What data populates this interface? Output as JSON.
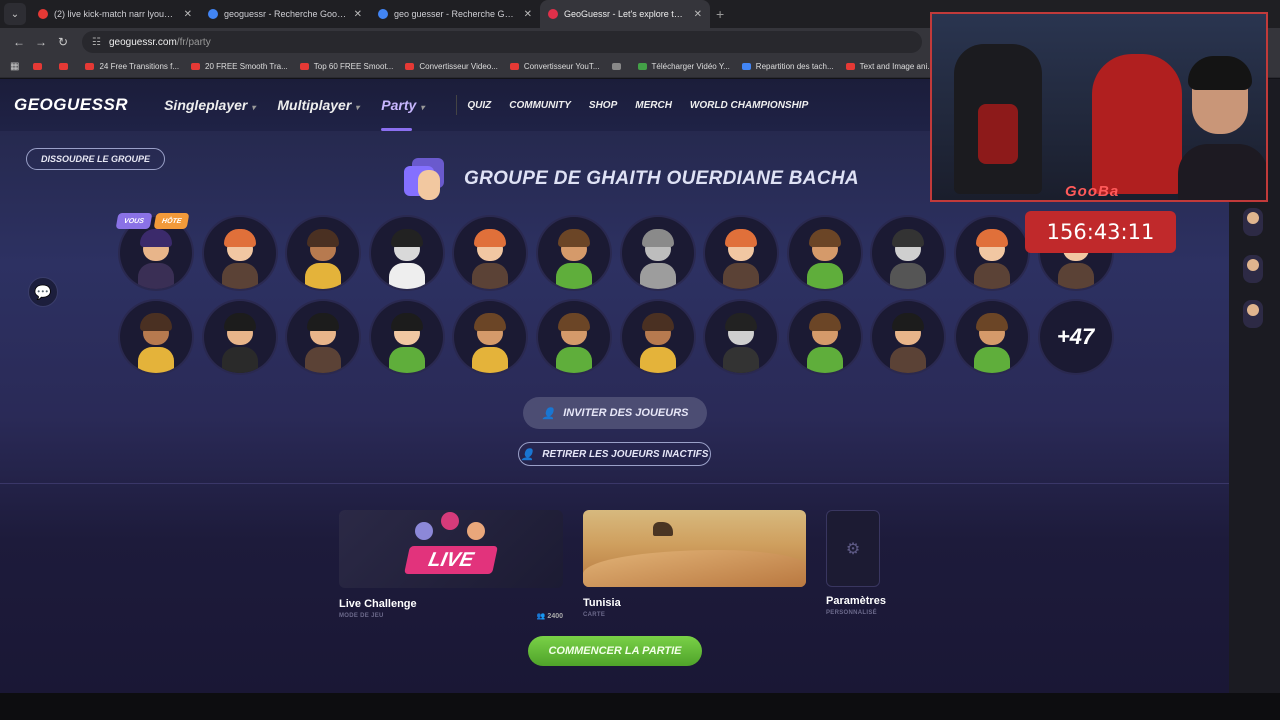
{
  "browser": {
    "tabs": [
      {
        "title": "(2) live kick-match narr lyoum(v",
        "color": "#e53935"
      },
      {
        "title": "geoguessr - Recherche Google",
        "color": "#4285f4"
      },
      {
        "title": "geo guesser - Recherche Goog",
        "color": "#4285f4"
      },
      {
        "title": "GeoGuessr - Let's explore the w",
        "color": "#e0304a"
      }
    ],
    "url_host": "geoguessr.com",
    "url_path": "/fr/party",
    "bookmarks": [
      "",
      "",
      "24 Free Transitions f...",
      "20 FREE Smooth Tra...",
      "Top 60 FREE Smoot...",
      "Convertisseur Video...",
      "Convertisseur YouT...",
      "",
      "Télécharger Vidéo Y...",
      "Repartition des tach...",
      "Text and Image ani..."
    ]
  },
  "nav": {
    "logo": "GEOGUESSR",
    "main": [
      "Singleplayer",
      "Multiplayer",
      "Party"
    ],
    "secondary": [
      "QUIZ",
      "COMMUNITY",
      "SHOP",
      "MERCH",
      "WORLD CHAMPIONSHIP"
    ]
  },
  "party": {
    "dissolve_label": "DISSOUDRE LE GROUPE",
    "title": "GROUPE DE GHAITH OUERDIANE BACHA",
    "badge_you": "VOUS",
    "badge_host": "HÔTE",
    "more_count": "+47",
    "invite_label": "INVITER DES JOUEURS",
    "remove_label": "RETIRER LES JOUEURS INACTIFS",
    "avatars": [
      {
        "hair": "#3b2a6b",
        "skin": "#e8b58a",
        "shirt": "#3a2f55"
      },
      {
        "hair": "#e0703a",
        "skin": "#f1c7a2",
        "shirt": "#5b4236"
      },
      {
        "hair": "#4a3022",
        "skin": "#b77a4f",
        "shirt": "#e4b33a"
      },
      {
        "hair": "#222222",
        "skin": "#d9d9d9",
        "shirt": "#eeeeee"
      },
      {
        "hair": "#e0703a",
        "skin": "#f1c7a2",
        "shirt": "#5b4236"
      },
      {
        "hair": "#6b4526",
        "skin": "#d59a6a",
        "shirt": "#5fae3b"
      },
      {
        "hair": "#8a8a8a",
        "skin": "#bdbdbd",
        "shirt": "#9d9d9d"
      },
      {
        "hair": "#e0703a",
        "skin": "#f1c7a2",
        "shirt": "#5b4236"
      },
      {
        "hair": "#6b4526",
        "skin": "#d59a6a",
        "shirt": "#5fae3b"
      },
      {
        "hair": "#333333",
        "skin": "#cfcfcf",
        "shirt": "#555555"
      },
      {
        "hair": "#e0703a",
        "skin": "#f1c7a2",
        "shirt": "#5b4236"
      },
      {
        "hair": "#e0703a",
        "skin": "#f1c7a2",
        "shirt": "#5b4236"
      },
      {
        "hair": "#4a3022",
        "skin": "#b77a4f",
        "shirt": "#e4b33a"
      },
      {
        "hair": "#1c1c1c",
        "skin": "#e8b58a",
        "shirt": "#2a2a2a"
      },
      {
        "hair": "#1c1c1c",
        "skin": "#e8b58a",
        "shirt": "#5b4236"
      },
      {
        "hair": "#1c1c1c",
        "skin": "#f1c7a2",
        "shirt": "#5fae3b"
      },
      {
        "hair": "#6b4526",
        "skin": "#d59a6a",
        "shirt": "#e4b33a"
      },
      {
        "hair": "#6b4526",
        "skin": "#d59a6a",
        "shirt": "#5fae3b"
      },
      {
        "hair": "#4a3022",
        "skin": "#b77a4f",
        "shirt": "#e4b33a"
      },
      {
        "hair": "#222222",
        "skin": "#cfcfcf",
        "shirt": "#333333"
      },
      {
        "hair": "#6b4526",
        "skin": "#d59a6a",
        "shirt": "#5fae3b"
      },
      {
        "hair": "#1c1c1c",
        "skin": "#e8b58a",
        "shirt": "#5b4236"
      },
      {
        "hair": "#6b4526",
        "skin": "#d59a6a",
        "shirt": "#5fae3b"
      }
    ]
  },
  "game": {
    "mode_name": "Live Challenge",
    "mode_sub": "MODE DE JEU",
    "mode_players": "2400",
    "live_label": "LIVE",
    "map_name": "Tunisia",
    "map_sub": "CARTE",
    "settings_name": "Paramètres",
    "settings_sub": "PERSONNALISÉ",
    "start_label": "COMMENCER LA PARTIE"
  },
  "stream": {
    "cam_label": "GooBa",
    "timer": "156:43:11"
  }
}
